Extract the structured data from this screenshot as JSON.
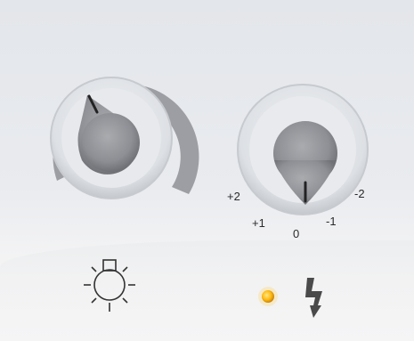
{
  "thermostat_knob": {
    "icon": "thermostat-scale-icon"
  },
  "selector_knob": {
    "positions": [
      "+2",
      "+1",
      "0",
      "-1",
      "-2"
    ]
  },
  "lamp_icon": "light-bulb-icon",
  "indicator_led": {
    "state": "on",
    "color": "#ffb300"
  },
  "power_icon": "lightning-bolt-icon",
  "colors": {
    "panel": "#e6e9ed",
    "knob": "#8f9196",
    "scale": "#9a9ca0",
    "led": "#ffb300"
  }
}
